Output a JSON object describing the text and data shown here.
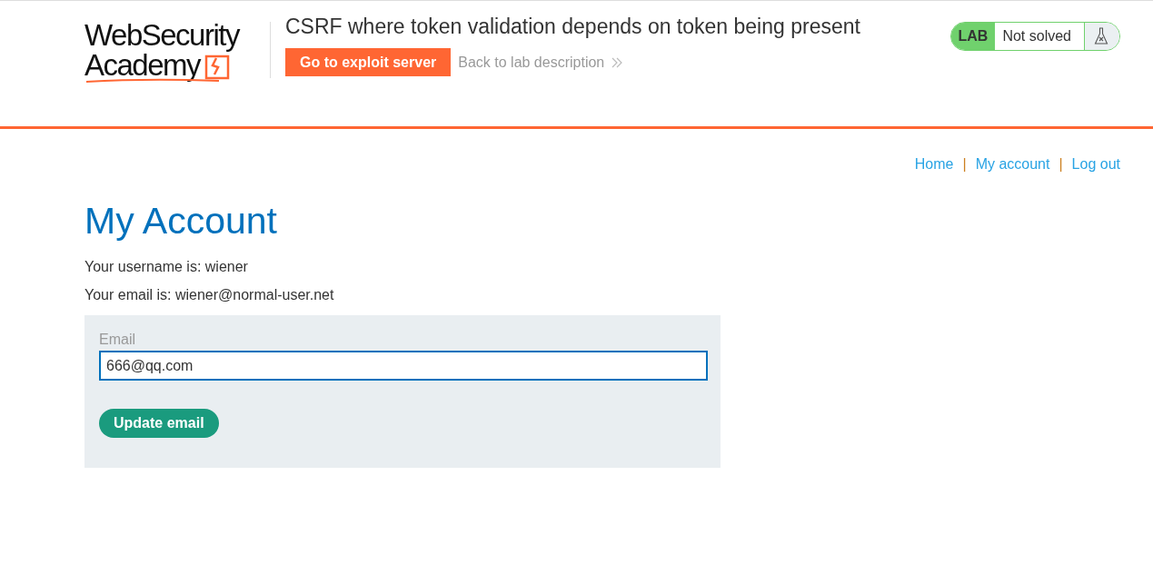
{
  "header": {
    "logo": {
      "line_1": "WebSecurity",
      "line_2": "Academy"
    },
    "lab_title": "CSRF where token validation depends on token being present",
    "exploit_button": "Go to exploit server",
    "back_link": "Back to lab description",
    "lab_status": {
      "badge": "LAB",
      "label": "Not solved",
      "solved": false
    }
  },
  "nav": [
    {
      "kind": "link",
      "label": "Home"
    },
    {
      "kind": "separator",
      "label": "|"
    },
    {
      "kind": "link",
      "label": "My account"
    },
    {
      "kind": "separator",
      "label": "|"
    },
    {
      "kind": "link",
      "label": "Log out"
    }
  ],
  "page_title": "My Account",
  "info": [
    "Your username is: wiener",
    "Your email is: wiener@normal-user.net"
  ],
  "form": {
    "field_label": "Email",
    "value": "666@qq.com",
    "submit": "Update email"
  }
}
